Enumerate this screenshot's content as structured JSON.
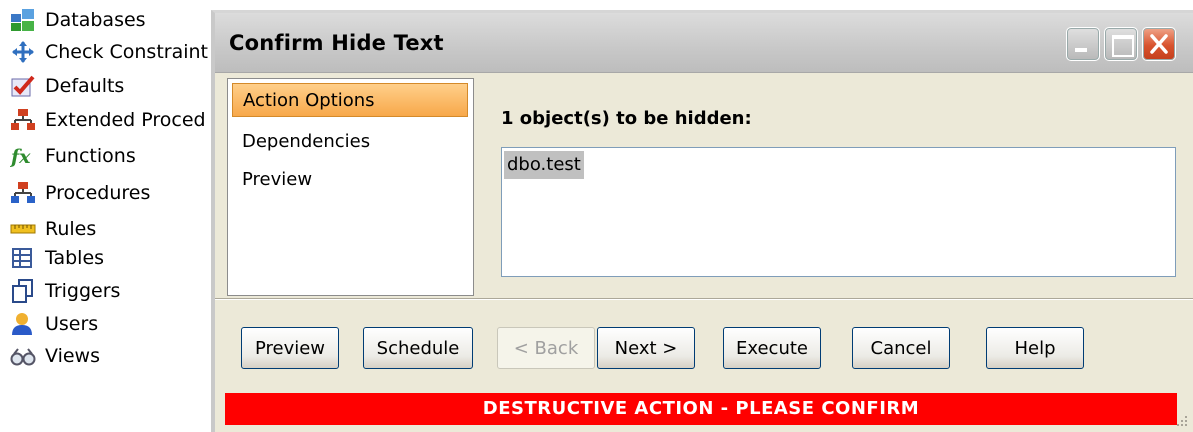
{
  "tree": {
    "items": [
      {
        "label": "Databases",
        "icon": "databases-icon"
      },
      {
        "label": "Check Constraint",
        "icon": "check-constraint-icon"
      },
      {
        "label": "Defaults",
        "icon": "defaults-icon"
      },
      {
        "label": "Extended Proced",
        "icon": "extended-procedures-icon"
      },
      {
        "label": "Functions",
        "icon": "functions-icon"
      },
      {
        "label": "Procedures",
        "icon": "procedures-icon"
      },
      {
        "label": "Rules",
        "icon": "rules-icon"
      },
      {
        "label": "Tables",
        "icon": "tables-icon"
      },
      {
        "label": "Triggers",
        "icon": "triggers-icon"
      },
      {
        "label": "Users",
        "icon": "users-icon"
      },
      {
        "label": "Views",
        "icon": "views-icon"
      }
    ]
  },
  "dialog": {
    "title": "Confirm Hide Text",
    "nav": [
      {
        "label": "Action Options",
        "selected": true
      },
      {
        "label": "Dependencies",
        "selected": false
      },
      {
        "label": "Preview",
        "selected": false
      }
    ],
    "heading": "1 object(s) to be hidden:",
    "objects": [
      "dbo.test"
    ],
    "buttons": {
      "preview": "Preview",
      "schedule": "Schedule",
      "back": "< Back",
      "next": "Next >",
      "execute": "Execute",
      "cancel": "Cancel",
      "help": "Help"
    },
    "warning": "DESTRUCTIVE ACTION - PLEASE CONFIRM"
  },
  "colors": {
    "warning_bar": "#ff0000",
    "selected_nav": "#f7a84a",
    "dialog_bg": "#ece9d8"
  }
}
